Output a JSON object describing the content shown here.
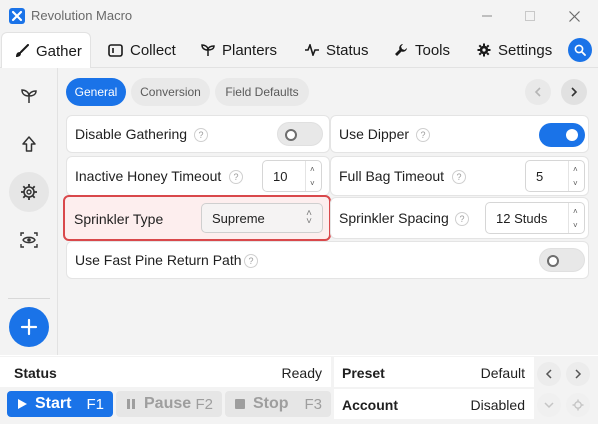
{
  "window": {
    "title": "Revolution Macro"
  },
  "tabs": [
    {
      "label": "Gather",
      "icon": "brush-icon",
      "active": true
    },
    {
      "label": "Collect",
      "icon": "ticket-icon"
    },
    {
      "label": "Planters",
      "icon": "sprout-icon"
    },
    {
      "label": "Status",
      "icon": "pulse-icon"
    },
    {
      "label": "Tools",
      "icon": "wrench-icon"
    },
    {
      "label": "Settings",
      "icon": "gear-icon"
    }
  ],
  "subtabs": [
    {
      "label": "General",
      "active": true
    },
    {
      "label": "Conversion"
    },
    {
      "label": "Field Defaults"
    }
  ],
  "settings": {
    "disable_gathering": {
      "label": "Disable Gathering",
      "on": false
    },
    "use_dipper": {
      "label": "Use Dipper",
      "on": true
    },
    "inactive_honey_timeout": {
      "label": "Inactive Honey Timeout",
      "value": "10"
    },
    "full_bag_timeout": {
      "label": "Full Bag Timeout",
      "value": "5"
    },
    "sprinkler_type": {
      "label": "Sprinkler Type",
      "value": "Supreme"
    },
    "sprinkler_spacing": {
      "label": "Sprinkler Spacing",
      "value": "12 Studs"
    },
    "use_fast_pine_return_path": {
      "label": "Use Fast Pine Return Path",
      "on": false
    }
  },
  "help_glyph": "?",
  "bottom": {
    "status_label": "Status",
    "status_value": "Ready",
    "preset_label": "Preset",
    "preset_value": "Default",
    "account_label": "Account",
    "account_value": "Disabled",
    "start": {
      "label": "Start",
      "key": "F1"
    },
    "pause": {
      "label": "Pause",
      "key": "F2"
    },
    "stop": {
      "label": "Stop",
      "key": "F3"
    }
  },
  "colors": {
    "accent": "#1a73e8",
    "highlight_border": "#d9484b",
    "highlight_bg": "#fdeeee"
  }
}
